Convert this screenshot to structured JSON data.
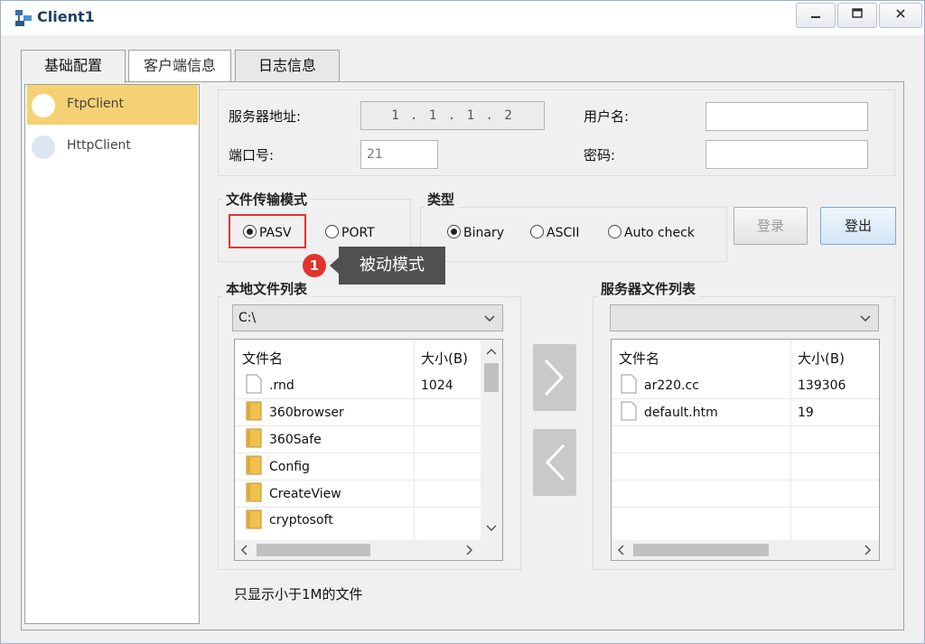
{
  "window": {
    "title": "Client1"
  },
  "tabs": [
    {
      "label": "基础配置"
    },
    {
      "label": "客户端信息"
    },
    {
      "label": "日志信息"
    }
  ],
  "clients": [
    {
      "label": "FtpClient",
      "selected": true
    },
    {
      "label": "HttpClient",
      "selected": false
    }
  ],
  "connection": {
    "server_address_label": "服务器地址:",
    "server_address_value": "1 . 1 . 1 . 2",
    "port_label": "端口号:",
    "port_value": "21",
    "username_label": "用户名:",
    "username_value": "",
    "password_label": "密码:",
    "password_value": ""
  },
  "transfer_mode": {
    "title": "文件传输模式",
    "options": [
      {
        "label": "PASV",
        "checked": true
      },
      {
        "label": "PORT",
        "checked": false
      }
    ]
  },
  "type_group": {
    "title": "类型",
    "options": [
      {
        "label": "Binary",
        "checked": true
      },
      {
        "label": "ASCII",
        "checked": false
      },
      {
        "label": "Auto check",
        "checked": false
      }
    ]
  },
  "buttons": {
    "login": "登录",
    "logout": "登出"
  },
  "callout": {
    "badge": "1",
    "text": "被动模式"
  },
  "local_files": {
    "title": "本地文件列表",
    "path": "C:\\",
    "col_name": "文件名",
    "col_size": "大小(B)",
    "rows": [
      {
        "name": ".rnd",
        "size": "1024",
        "type": "file"
      },
      {
        "name": "360browser",
        "size": "",
        "type": "folder"
      },
      {
        "name": "360Safe",
        "size": "",
        "type": "folder"
      },
      {
        "name": "Config",
        "size": "",
        "type": "folder"
      },
      {
        "name": "CreateView",
        "size": "",
        "type": "folder"
      },
      {
        "name": "cryptosoft",
        "size": "",
        "type": "folder"
      }
    ]
  },
  "server_files": {
    "title": "服务器文件列表",
    "path": "",
    "col_name": "文件名",
    "col_size": "大小(B)",
    "rows": [
      {
        "name": "ar220.cc",
        "size": "139306",
        "type": "file"
      },
      {
        "name": "default.htm",
        "size": "19",
        "type": "file"
      }
    ]
  },
  "filter_label": "只显示小于1M的文件",
  "colors": {
    "selected_item": "#f6d173",
    "callout_badge": "#e0332c",
    "callout_bg": "#505050"
  }
}
